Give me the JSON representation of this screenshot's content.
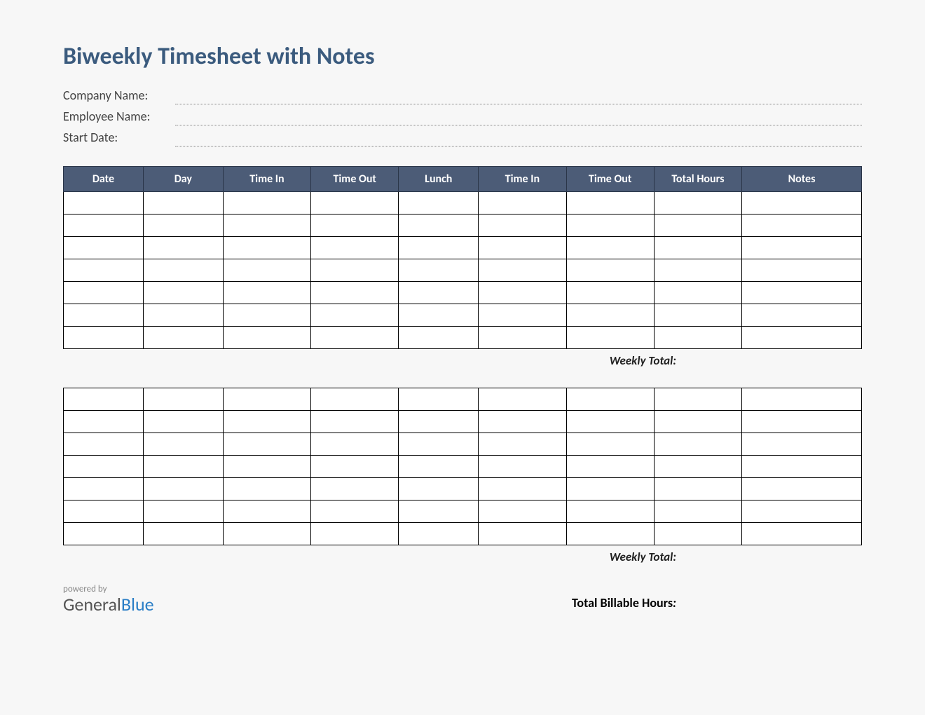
{
  "title": "Biweekly Timesheet with Notes",
  "info": {
    "company_label": "Company Name:",
    "employee_label": "Employee Name:",
    "start_date_label": "Start Date:",
    "company_value": "",
    "employee_value": "",
    "start_date_value": ""
  },
  "headers": {
    "date": "Date",
    "day": "Day",
    "time_in_1": "Time In",
    "time_out_1": "Time Out",
    "lunch": "Lunch",
    "time_in_2": "Time In",
    "time_out_2": "Time Out",
    "total_hours": "Total Hours",
    "notes": "Notes"
  },
  "week1_rows": 7,
  "week2_rows": 7,
  "weekly_total_label": "Weekly Total:",
  "weekly_total_1": "",
  "weekly_total_2": "",
  "total_billable_label": "Total Billable Hours",
  "total_billable_colon": ":",
  "total_billable_value": "",
  "footer": {
    "powered_by": "powered by",
    "brand_general": "General",
    "brand_blue": "Blue"
  }
}
